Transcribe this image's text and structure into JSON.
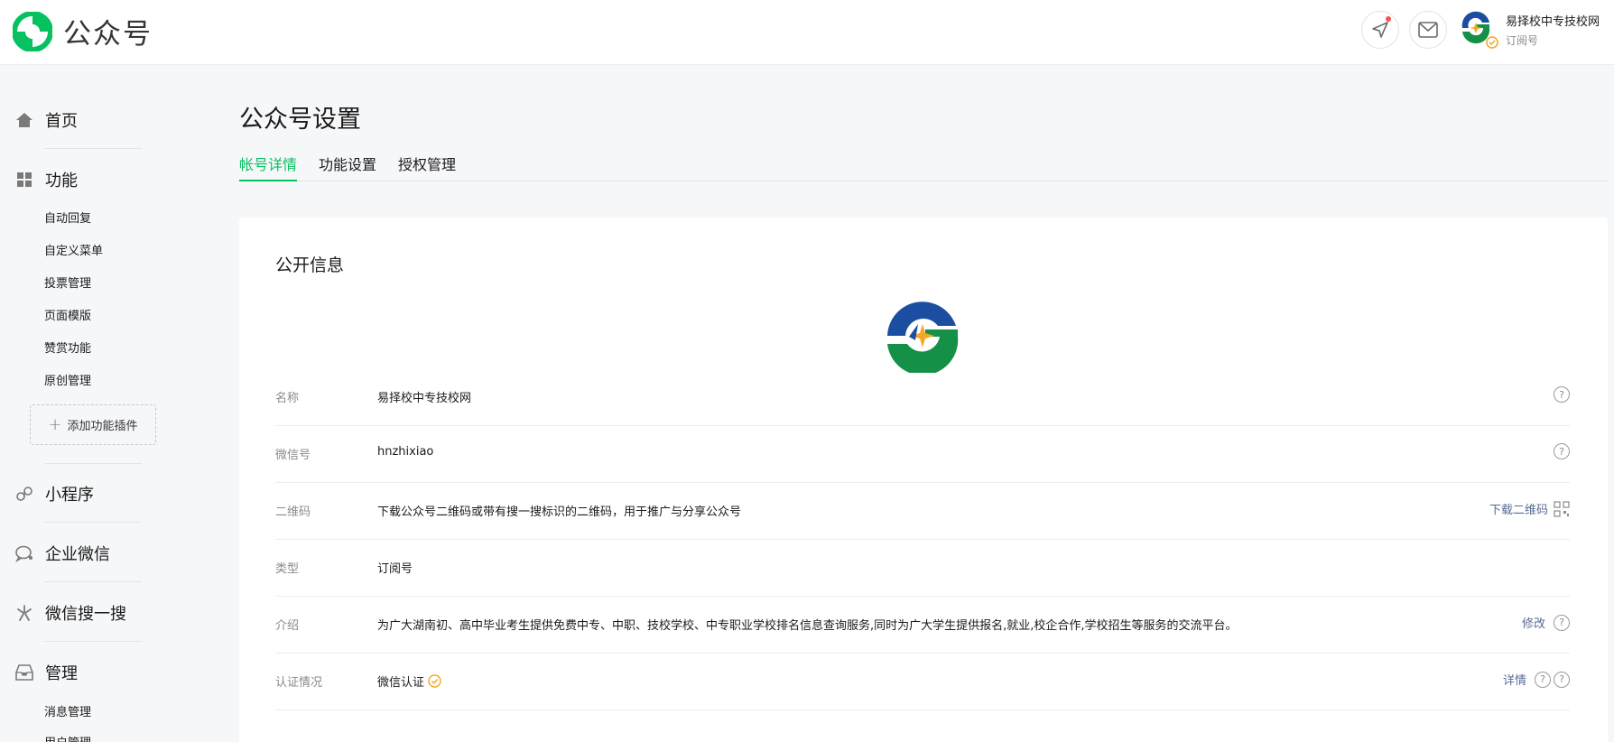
{
  "app": {
    "name": "公众号"
  },
  "header": {
    "account_name": "易择校中专技校网",
    "account_type": "订阅号"
  },
  "sidebar": {
    "home": "首页",
    "features": "功能",
    "feature_items": [
      "自动回复",
      "自定义菜单",
      "投票管理",
      "页面模版",
      "赞赏功能",
      "原创管理"
    ],
    "add_plugin": "添加功能插件",
    "mini_program": "小程序",
    "work_wechat": "企业微信",
    "search": "微信搜一搜",
    "manage": "管理",
    "manage_items": [
      "消息管理",
      "用户管理"
    ]
  },
  "page": {
    "title": "公众号设置",
    "tabs": [
      "帐号详情",
      "功能设置",
      "授权管理"
    ],
    "active_tab": 0
  },
  "card": {
    "title": "公开信息",
    "rows": [
      {
        "label": "名称",
        "value": "易择校中专技校网",
        "link": ""
      },
      {
        "label": "微信号",
        "value": "hnzhixiao",
        "link": ""
      },
      {
        "label": "二维码",
        "value": "下载公众号二维码或带有搜一搜标识的二维码，用于推广与分享公众号",
        "link": "下载二维码"
      },
      {
        "label": "类型",
        "value": "订阅号",
        "link": ""
      },
      {
        "label": "介绍",
        "value": "为广大湖南初、高中毕业考生提供免费中专、中职、技校学校、中专职业学校排名信息查询服务,同时为广大学生提供报名,就业,校企合作,学校招生等服务的交流平台。",
        "link": "修改"
      },
      {
        "label": "认证情况",
        "value": "微信认证",
        "link": "详情"
      }
    ]
  },
  "colors": {
    "accent": "#07c160",
    "link": "#576b95",
    "verify": "#f5a623"
  },
  "icons": {
    "logo": "wechat-official-logo",
    "notify": "paper-plane-icon",
    "mail": "mail-icon",
    "home": "home-icon",
    "features": "grid-icon",
    "mini_program": "link-icon",
    "work_wechat": "chat-icon",
    "search": "search-star-icon",
    "manage": "inbox-icon",
    "help": "help-icon",
    "verify": "verified-check-icon"
  }
}
